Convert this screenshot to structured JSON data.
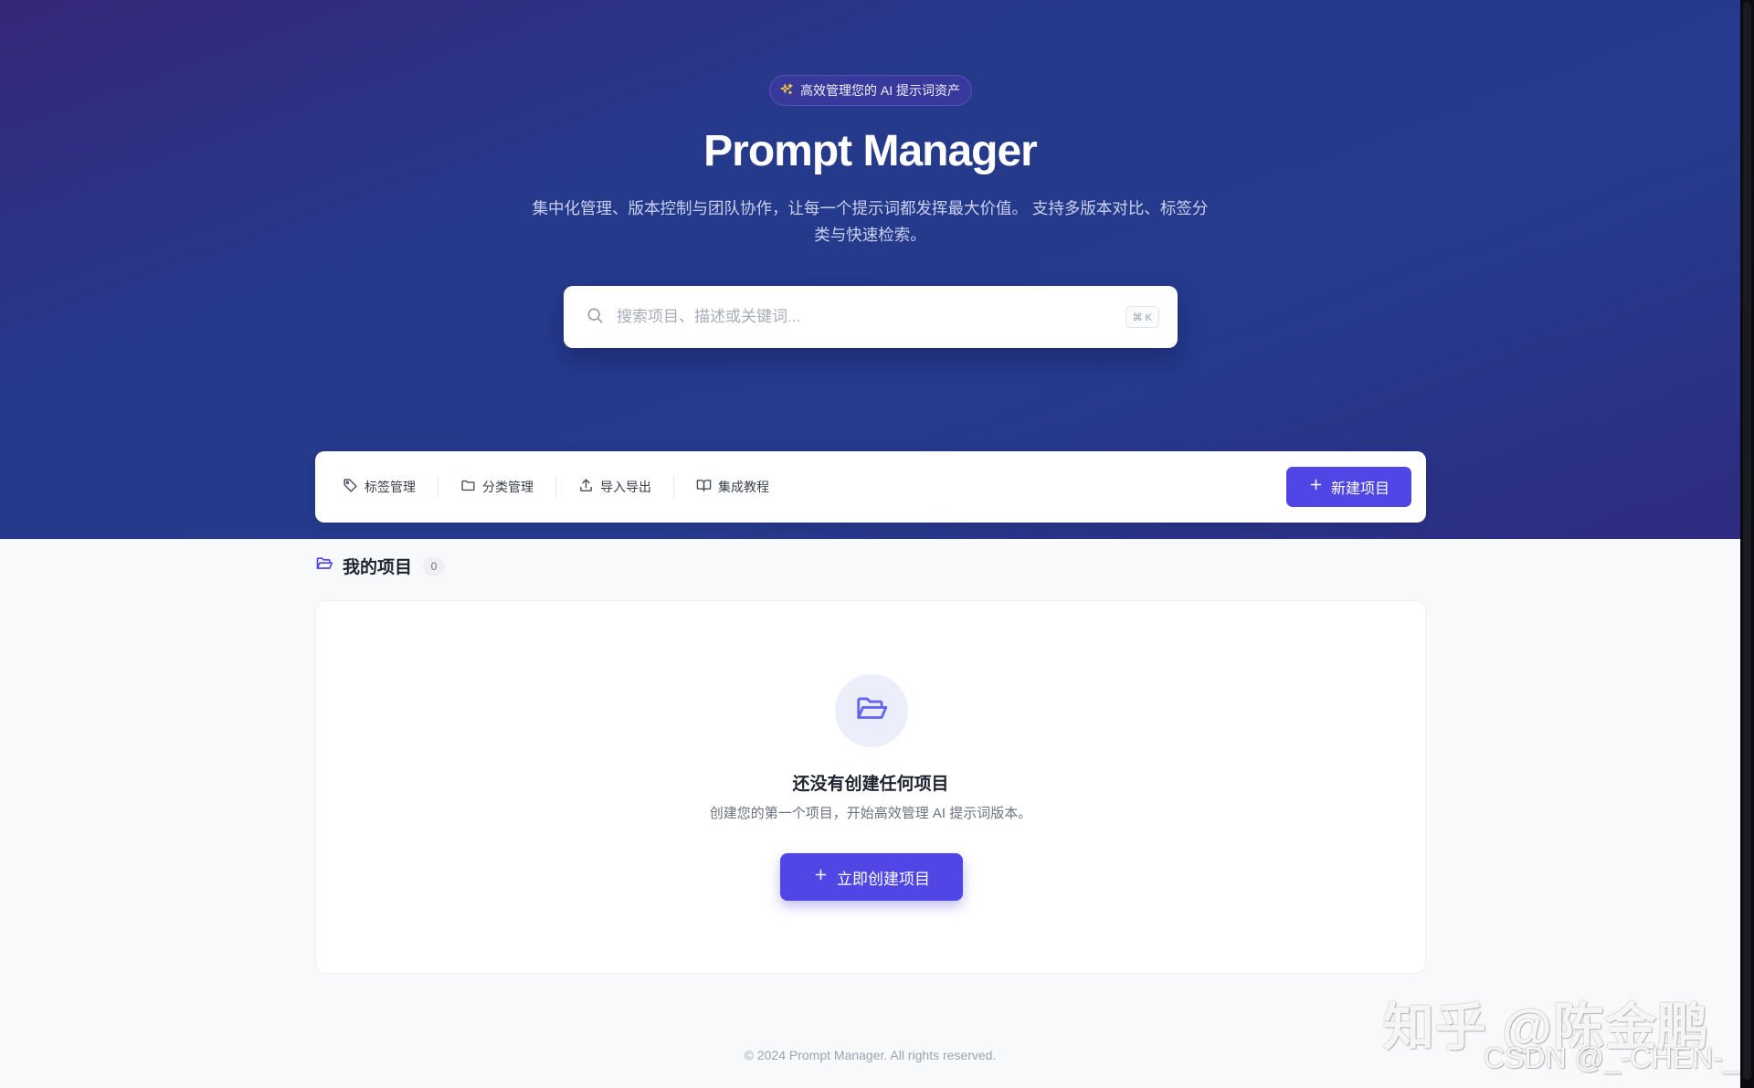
{
  "hero": {
    "badge_text": "高效管理您的 AI 提示词资产",
    "badge_icon": "sparkles-icon",
    "title": "Prompt Manager",
    "subtitle_line1": "集中化管理、版本控制与团队协作，让每一个提示词都发挥最大价值。 支持多版本对比、标签分",
    "subtitle_line2": "类与快速检索。"
  },
  "search": {
    "placeholder": "搜索项目、描述或关键词...",
    "value": "",
    "shortcut": "⌘ K",
    "icon": "search-icon"
  },
  "toolbar": {
    "items": [
      {
        "label": "标签管理",
        "icon": "tag-icon"
      },
      {
        "label": "分类管理",
        "icon": "folder-icon"
      },
      {
        "label": "导入导出",
        "icon": "upload-icon"
      },
      {
        "label": "集成教程",
        "icon": "book-open-icon"
      }
    ],
    "new_button_label": "新建项目"
  },
  "projects": {
    "title": "我的项目",
    "count": "0",
    "empty_title": "还没有创建任何项目",
    "empty_desc": "创建您的第一个项目，开始高效管理 AI 提示词版本。",
    "create_button_label": "立即创建项目"
  },
  "footer": {
    "copyright": "© 2024 Prompt Manager. All rights reserved."
  },
  "watermark": {
    "line1": "知乎 @陈金鹏",
    "line2": "CSDN @_-CHEN-_"
  },
  "colors": {
    "accent": "#4f46e5",
    "hero_start": "#35277a",
    "hero_end": "#263b8d",
    "page_bg": "#f8f9fb"
  }
}
